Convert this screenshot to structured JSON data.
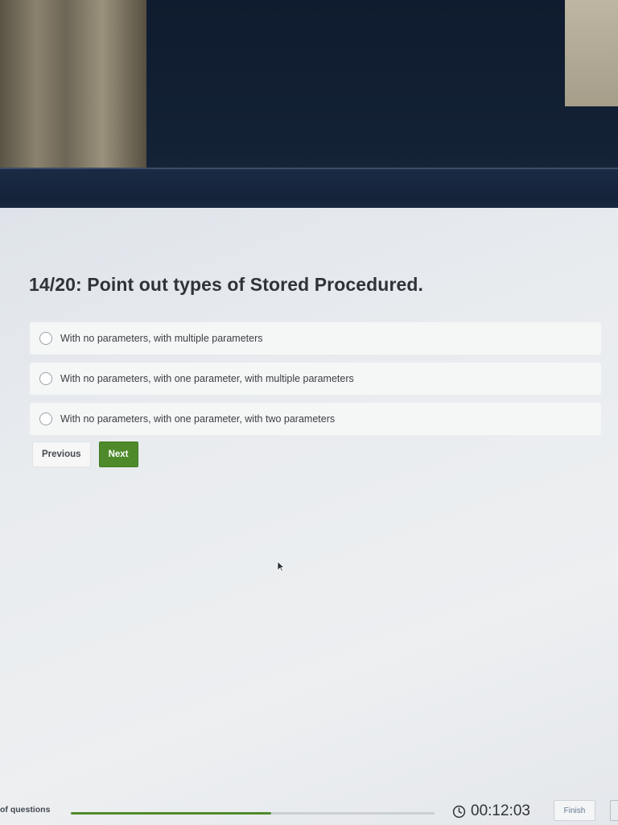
{
  "question": {
    "title": "14/20: Point out types of Stored Procedured."
  },
  "options": [
    {
      "label": "With no parameters, with multiple parameters",
      "selected": false
    },
    {
      "label": "With no parameters, with one parameter, with multiple parameters",
      "selected": false
    },
    {
      "label": "With no parameters, with one parameter, with two parameters",
      "selected": false
    }
  ],
  "nav": {
    "previous_label": "Previous",
    "next_label": "Next"
  },
  "footer": {
    "questions_label": "of questions",
    "progress_fraction": 0.55,
    "timer": "00:12:03",
    "finish_label": "Finish"
  },
  "icons": {
    "radio": "radio-unchecked-icon",
    "clock": "clock-icon",
    "cursor": "mouse-pointer-icon"
  },
  "colors": {
    "accent_green": "#4e8a2a",
    "progress_green": "#4f8a2c",
    "text_dark": "#2f3337"
  }
}
